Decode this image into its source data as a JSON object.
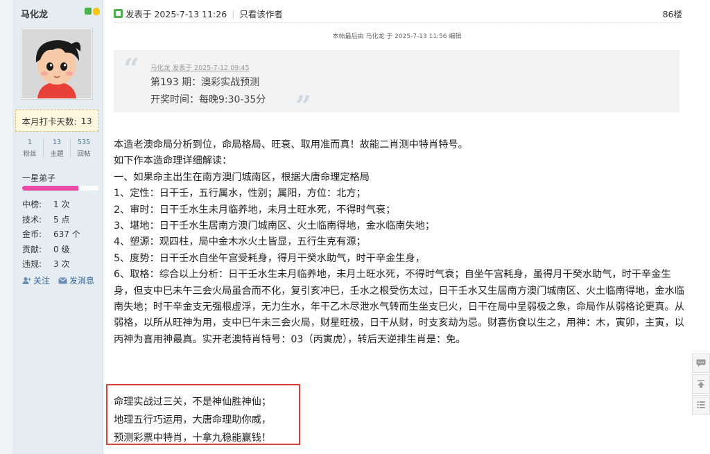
{
  "sidebar": {
    "username": "马化龙",
    "checkin": {
      "label": "本月打卡天数:",
      "value": "13"
    },
    "stats": [
      {
        "num": "1",
        "label": "粉丝"
      },
      {
        "num": "13",
        "label": "主题"
      },
      {
        "num": "535",
        "label": "回帖"
      }
    ],
    "rank": {
      "title": "一星弟子",
      "progress": 0.74,
      "color": "#ea4ca5"
    },
    "info": [
      {
        "k": "中榜:",
        "v": "1 次"
      },
      {
        "k": "技术:",
        "v": "5 点"
      },
      {
        "k": "金币:",
        "v": "637 个"
      },
      {
        "k": "贡献:",
        "v": "0 级"
      },
      {
        "k": "违规:",
        "v": "3 次"
      }
    ],
    "actions": {
      "follow": "关注",
      "message": "发消息"
    }
  },
  "post": {
    "posted_at": "发表于 2025-7-13 11:26",
    "only_author": "只看该作者",
    "floor": "86楼",
    "edit_note": "本帖最后由 马化龙 于 2025-7-13 11:56 编辑",
    "quote": {
      "author": "马化龙 发表于 2025-7-12 09:45",
      "line1": "第193 期：澳彩实战预测",
      "line2": "开奖时间：每晚9:30-35分"
    },
    "lines": [
      "本造老澳命局分析到位，命局格局、旺衰、取用准而真！故能二肖测中特肖特号。",
      "如下作本造命理详细解读：",
      "一、如果命主出生在南方澳门城南区，根据大唐命理定格局",
      "1、定性：日干壬，五行属水，性别；属阳，方位：北方；",
      "2、审时：日干壬水生未月临养地，未月土旺水死，不得时气衰；",
      "3、堪地：日干壬水生居南方澳门城南区、火土临南得地，金水临南失地；",
      "4、塑源：观四柱，局中金木水火土皆显，五行生克有源；",
      "5、度势：日干壬水自坐午宫受耗身，得月干癸水助气，时干辛金生身，",
      "6、取格：综合以上分析：日干壬水生未月临养地，未月土旺水死，不得时气衰；自坐午宫耗身，虽得月干癸水助气，时干辛金生身，但支中巳未午三会火局虽合而不化，复引亥冲巳，壬水之根受伤太过，日干壬水又生居南方澳门城南区、火土临南得地，金水临南失地；时干辛金支无强根虚浮，无力生水，年干乙木尽泄水气转而生坐支巳火，日干在局中呈弱极之象，命局作从弱格论更真。从弱格，以所从旺神为用，支中巳午未三会火局，财星旺极，日干从财，时支亥劫为忌。财喜伤食以生之，用神：木，寅卯，主寅，以丙神为喜用神最真。实开老澳特肖特号：03（丙寅虎），转后天逆排生肖是：免。"
    ],
    "poem": [
      "命理实战过三关，不是神仙胜神仙；",
      "地理五行巧运用，大唐命理助你威，",
      "预测彩票中特肖，十拿九稳能赢钱！"
    ]
  }
}
